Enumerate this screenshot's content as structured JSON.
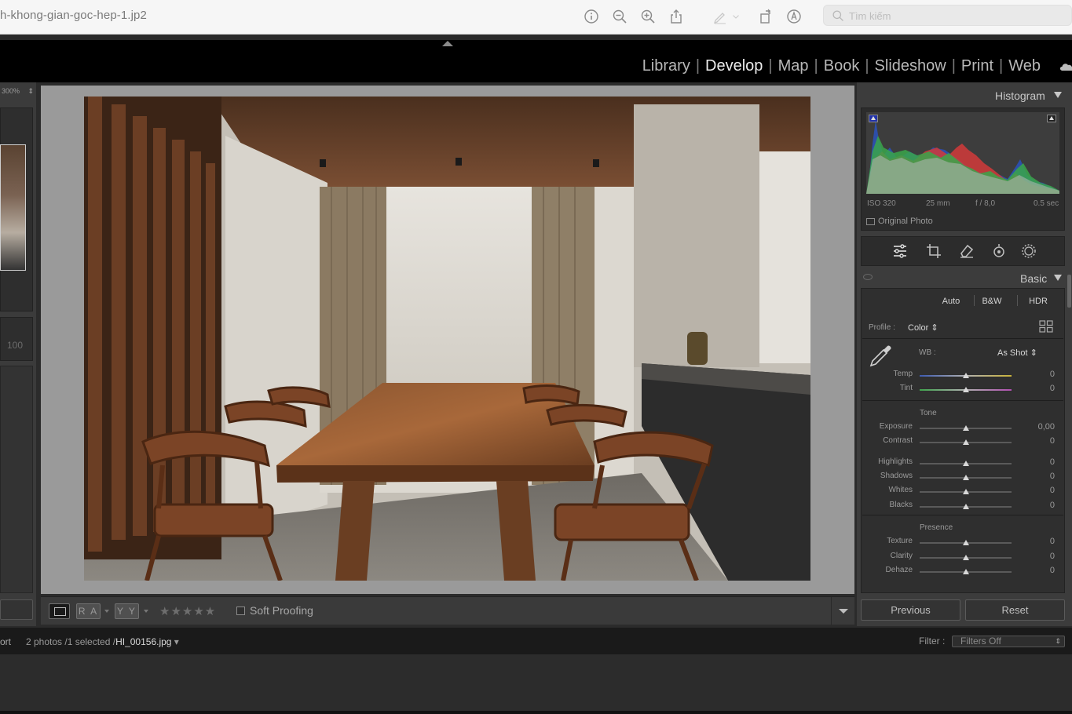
{
  "window": {
    "title": "h-khong-gian-goc-hep-1.jp2",
    "search_placeholder": "Tìm kiếm"
  },
  "toolbar_icons": [
    "info-icon",
    "zoom-out-icon",
    "zoom-in-icon",
    "share-icon",
    "markup-icon",
    "rotate-icon",
    "annotate-icon"
  ],
  "modules": {
    "library": "Library",
    "develop": "Develop",
    "map": "Map",
    "book": "Book",
    "slideshow": "Slideshow",
    "print": "Print",
    "web": "Web",
    "active": "Develop"
  },
  "navigator": {
    "zoom": "300%",
    "hundred": "100"
  },
  "histogram": {
    "title": "Histogram",
    "iso": "ISO 320",
    "focal": "25 mm",
    "aperture": "f / 8,0",
    "shutter": "0.5 sec",
    "original_photo": "Original Photo"
  },
  "basic": {
    "title": "Basic",
    "auto": "Auto",
    "bw": "B&W",
    "hdr": "HDR",
    "profile_label": "Profile :",
    "profile_value": "Color",
    "wb_label": "WB :",
    "wb_value": "As Shot",
    "tone_label": "Tone",
    "presence_label": "Presence",
    "sliders": {
      "temp": {
        "label": "Temp",
        "value": "0",
        "position": 0.5
      },
      "tint": {
        "label": "Tint",
        "value": "0",
        "position": 0.5
      },
      "exposure": {
        "label": "Exposure",
        "value": "0,00",
        "position": 0.5
      },
      "contrast": {
        "label": "Contrast",
        "value": "0",
        "position": 0.5
      },
      "highlights": {
        "label": "Highlights",
        "value": "0",
        "position": 0.5
      },
      "shadows": {
        "label": "Shadows",
        "value": "0",
        "position": 0.5
      },
      "whites": {
        "label": "Whites",
        "value": "0",
        "position": 0.5
      },
      "blacks": {
        "label": "Blacks",
        "value": "0",
        "position": 0.5
      },
      "texture": {
        "label": "Texture",
        "value": "0",
        "position": 0.5
      },
      "clarity": {
        "label": "Clarity",
        "value": "0",
        "position": 0.5
      },
      "dehaze": {
        "label": "Dehaze",
        "value": "0",
        "position": 0.5
      }
    }
  },
  "bottom_toolbar": {
    "ra": "R A",
    "yy": "Y Y",
    "stars": "★★★★★",
    "soft_proofing": "Soft Proofing"
  },
  "buttons": {
    "previous": "Previous",
    "reset": "Reset"
  },
  "status": {
    "left": "ort",
    "photos": "2 photos /1 selected /",
    "filename": "HI_00156.jpg",
    "filter_label": "Filter :",
    "filter_value": "Filters Off"
  }
}
